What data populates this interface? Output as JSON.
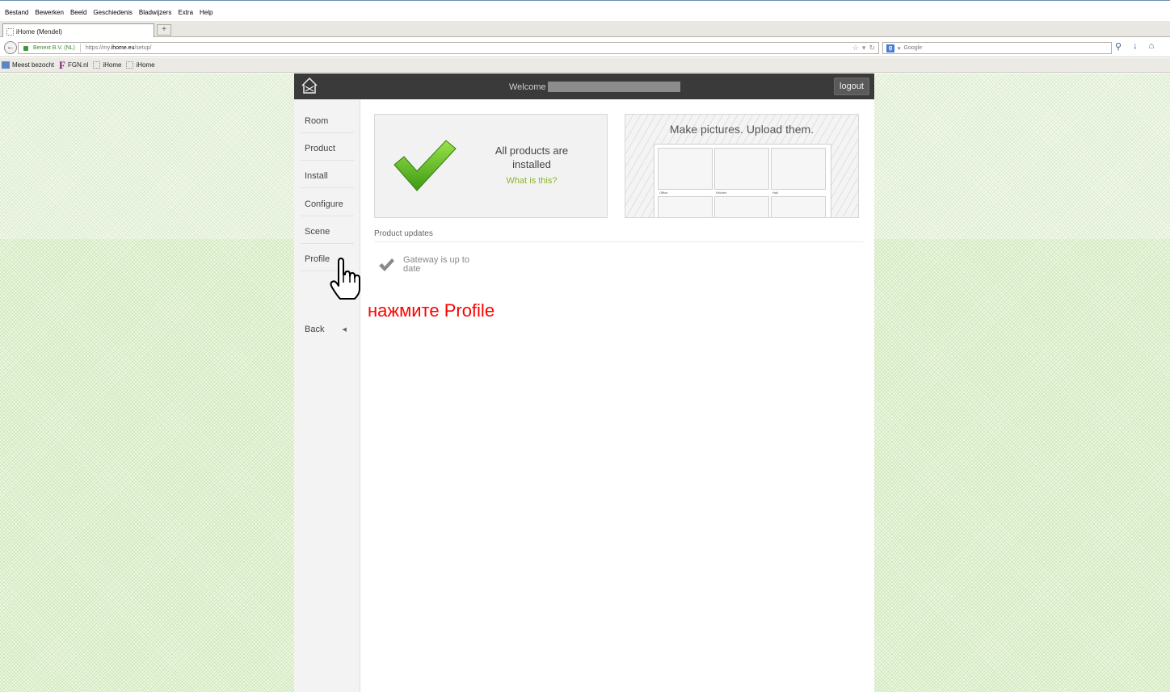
{
  "browser": {
    "menu": [
      "Bestand",
      "Bewerken",
      "Beeld",
      "Geschiedenis",
      "Bladwijzers",
      "Extra",
      "Help"
    ],
    "tab_title": "iHome (Mendel)",
    "new_tab": "+",
    "identity": "Benext B.V. (NL)",
    "url_prefix": "https://my.",
    "url_host": "ihome.eu",
    "url_path": "/setup/",
    "search_placeholder": "Google",
    "bookmarks": [
      "Meest bezocht",
      "FGN.nl",
      "iHome",
      "iHome"
    ]
  },
  "app": {
    "welcome": "Welcome",
    "logout": "logout",
    "sidebar": [
      "Room",
      "Product",
      "Install",
      "Configure",
      "Scene",
      "Profile"
    ],
    "back": "Back",
    "status_message": "All products are installed",
    "status_link": "What is this?",
    "pictures_headline": "Make pictures. Upload them.",
    "room_labels": [
      "Office",
      "Kitchen",
      "Hall"
    ],
    "updates_heading": "Product updates",
    "gateway_status": "Gateway is up to date"
  },
  "annotation": "нажмите Profile",
  "colors": {
    "annotation": "#ff0000",
    "link": "#8bb82a",
    "topbar": "#3a3a3a"
  }
}
